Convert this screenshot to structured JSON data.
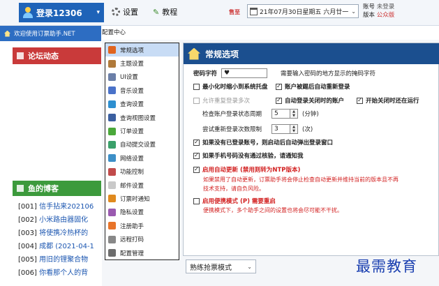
{
  "toolbar": {
    "login_label": "登录12306",
    "settings_label": "设置",
    "tutorial_label": "教程",
    "sale_label": "售至",
    "date_value": "21年07月30日星期五 六月廿一",
    "account_label": "账号",
    "account_value": "未登录",
    "version_label": "版本",
    "version_value": "公众版"
  },
  "left": {
    "welcome": "欢迎使用订票助手.NET",
    "forum_title": "论坛动态",
    "blog_title": "鱼的博客",
    "blog_items": [
      {
        "num": "[001]",
        "title": "信手拈来202106"
      },
      {
        "num": "[002]",
        "title": "小米路由器固化"
      },
      {
        "num": "[003]",
        "title": "将使携冷热杯的"
      },
      {
        "num": "[004]",
        "title": "成都 (2021-04-1"
      },
      {
        "num": "[005]",
        "title": "用旧的锂聚合物"
      },
      {
        "num": "[006]",
        "title": "你看那个人的背"
      }
    ]
  },
  "config": {
    "window_title": "配置中心",
    "menu": [
      {
        "label": "常规选项",
        "icon": "home-icon",
        "color": "#e0641e"
      },
      {
        "label": "主题设置",
        "icon": "brush-icon",
        "color": "#b07a3a"
      },
      {
        "label": "UI设置",
        "icon": "ui-icon",
        "color": "#6b7fa8"
      },
      {
        "label": "音乐设置",
        "icon": "music-icon",
        "color": "#4a72c9"
      },
      {
        "label": "查询设置",
        "icon": "query-icon",
        "color": "#2d8fd0"
      },
      {
        "label": "查询视图设置",
        "icon": "view-icon",
        "color": "#3b5fa0"
      },
      {
        "label": "订单设置",
        "icon": "order-icon",
        "color": "#4aa83a"
      },
      {
        "label": "自动提交设置",
        "icon": "auto-submit-icon",
        "color": "#3aa06a"
      },
      {
        "label": "网络设置",
        "icon": "network-icon",
        "color": "#3d8fc7"
      },
      {
        "label": "功能控制",
        "icon": "function-icon",
        "color": "#c14b4b"
      },
      {
        "label": "邮件设置",
        "icon": "mail-icon",
        "color": "#c9c9c9"
      },
      {
        "label": "订票时通知",
        "icon": "notify-icon",
        "color": "#e08a1e"
      },
      {
        "label": "隐私设置",
        "icon": "privacy-icon",
        "color": "#9a5ab0"
      },
      {
        "label": "注册助手",
        "icon": "heart-icon",
        "color": "#e8742a"
      },
      {
        "label": "远程打码",
        "icon": "remote-icon",
        "color": "#888888"
      },
      {
        "label": "配置管理",
        "icon": "config-icon",
        "color": "#6d6d6d"
      }
    ],
    "panel_title": "常规选项",
    "password_char_label": "密码字符",
    "password_char_value": "♥",
    "password_char_hint": "需要输入密码的地方显示的掩码字符",
    "minimize_tray": "最小化时缩小到系统托盘",
    "relogin_after_expire": "账户被踢后自动重新登录",
    "allow_multi_login": "允许重复登录多次",
    "auto_login_last": "自动登录关闭时的账户",
    "resume_on_start": "开始关闭时还在运行",
    "check_cycle_label": "检查账户登录状态周期",
    "check_cycle_value": "5",
    "check_cycle_unit": "(分钟)",
    "retry_label": "尝试重新登录次数限制",
    "retry_value": "3",
    "retry_unit": "(次)",
    "auto_popup_login": "如果没有已登录账号，则启动后自动弹出登录窗口",
    "phone_verify": "如果手机号码没有通过核验，请通知我",
    "auto_update": "启用自动更新 (禁用则转为NTP版本)",
    "auto_update_note_1": "如果禁用了自动更新，订票助手将会停止检查自动更新并维持当前的版本且不再",
    "auto_update_note_2": "技术支持，请自负风险。",
    "portable_mode": "启用便携模式 (P)  需要重启",
    "portable_note": "便携模式下，多个助手之间的设置也将会尽可能不干扰。",
    "grab_mode": "熟练抢票模式"
  },
  "watermark": "最需教育"
}
